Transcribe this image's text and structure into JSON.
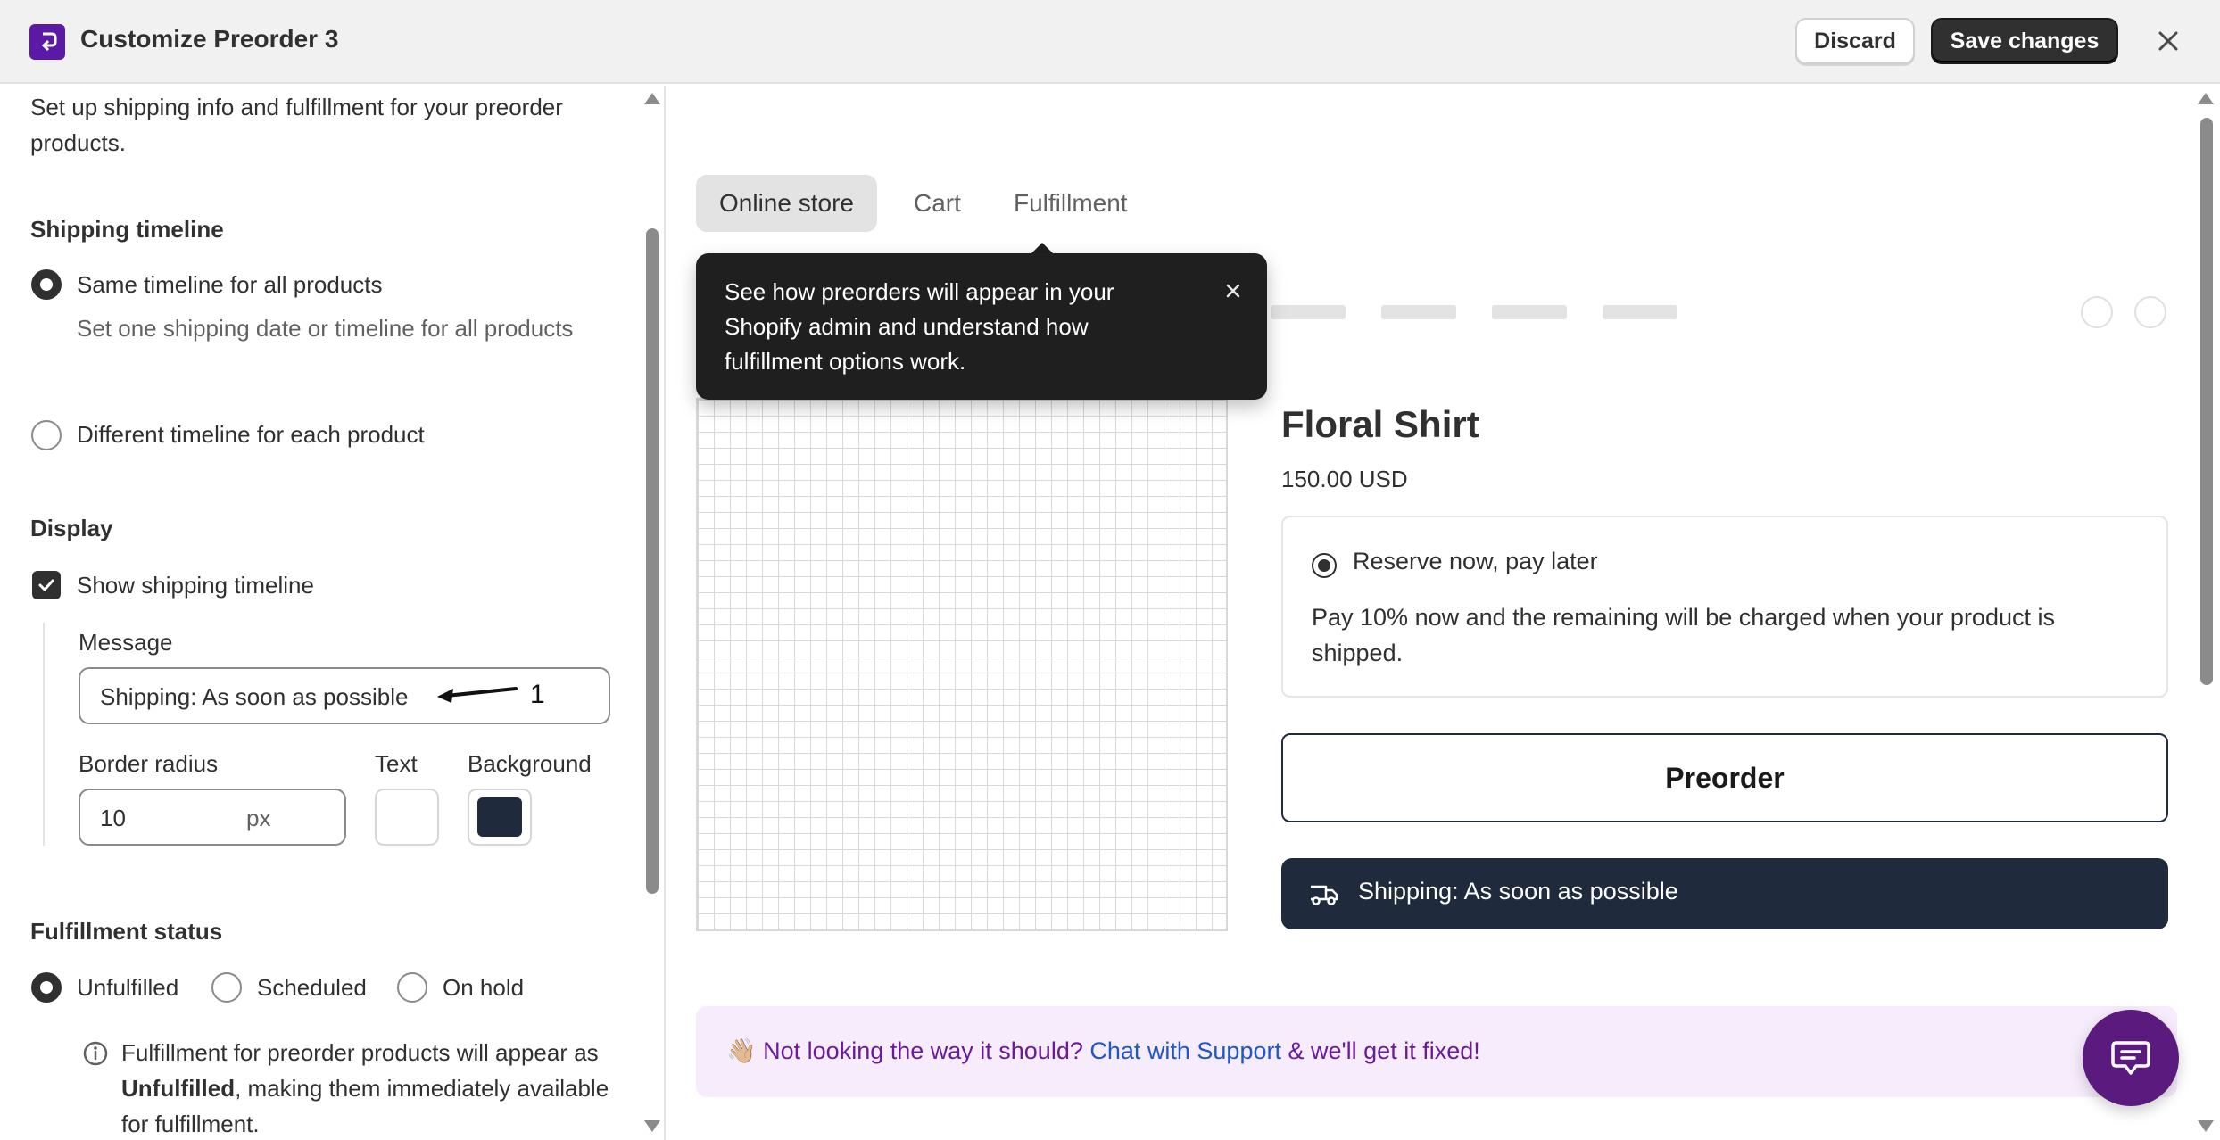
{
  "header": {
    "title": "Customize Preorder 3",
    "discard_label": "Discard",
    "save_label": "Save changes",
    "close_icon": "close-icon"
  },
  "settings": {
    "intro": "Set up shipping info and fulfillment for your preorder products.",
    "shipping_timeline": {
      "heading": "Shipping timeline",
      "option_same": "Same timeline for all products",
      "option_same_desc": "Set one shipping date or timeline for all products",
      "option_different": "Different timeline for each product",
      "selected": "same"
    },
    "display": {
      "heading": "Display",
      "show_timeline_label": "Show shipping timeline",
      "show_timeline_checked": true,
      "message_label": "Message",
      "message_value": "Shipping: As soon as possible",
      "border_radius_label": "Border radius",
      "border_radius_value": "10",
      "border_radius_unit": "px",
      "text_label": "Text",
      "text_color": "#ffffff",
      "background_label": "Background",
      "background_color": "#1f2a3c"
    },
    "fulfillment_status": {
      "heading": "Fulfillment status",
      "options": [
        "Unfulfilled",
        "Scheduled",
        "On hold"
      ],
      "selected": "Unfulfilled",
      "info_prefix": "Fulfillment for preorder products will appear as ",
      "info_bold": "Unfulfilled",
      "info_suffix": ", making them immediately available for fulfillment."
    }
  },
  "preview": {
    "tabs": [
      "Online store",
      "Cart",
      "Fulfillment"
    ],
    "active_tab": "Online store",
    "tooltip": "See how preorders will appear in your Shopify admin and understand how fulfillment options work.",
    "product": {
      "title": "Floral Shirt",
      "price": "150.00 USD",
      "option_label": "Reserve now, pay later",
      "option_desc": "Pay 10% now and the remaining will be charged when your product is shipped.",
      "preorder_button": "Preorder",
      "shipping_message": "Shipping: As soon as possible"
    },
    "banner": {
      "emoji": "👋🏼",
      "prefix": "Not looking the way it should? ",
      "link": "Chat with Support",
      "suffix": " & we'll get it fixed!"
    }
  },
  "annotation": {
    "number": "1"
  },
  "colors": {
    "brand": "#5b19a6",
    "ship_bar_bg": "#1f2a3c",
    "banner_bg": "#f7ecfc",
    "banner_text": "#6a1b9a",
    "link": "#1f56c8"
  }
}
